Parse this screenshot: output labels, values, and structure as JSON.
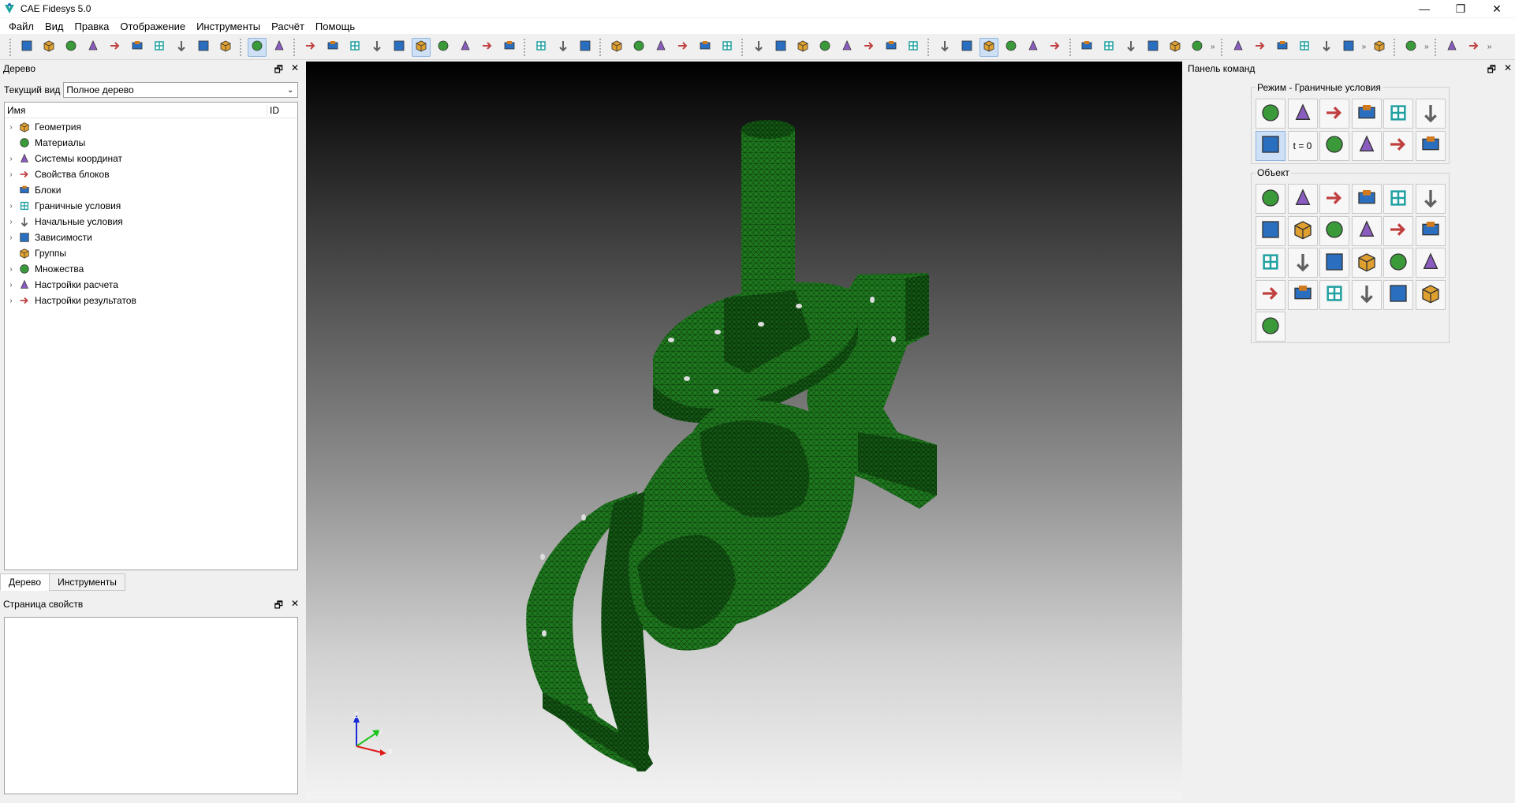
{
  "window": {
    "title": "CAE Fidesys 5.0",
    "minimize": "—",
    "restore": "❐",
    "close": "✕"
  },
  "menu": [
    "Файл",
    "Вид",
    "Правка",
    "Отображение",
    "Инструменты",
    "Расчёт",
    "Помощь"
  ],
  "toolbar": {
    "icons": [
      "new-file-icon",
      "open-folder-icon",
      "save-icon",
      "import-icon",
      "export-icon",
      "script-icon",
      "play-script-icon",
      "id-icon",
      "record-icon",
      "hammer-icon",
      "select-icon",
      "undo-icon",
      "wireframe-cube-icon",
      "hidden-cube-icon",
      "shaded-cube-icon",
      "solid-cube-icon",
      "smooth-shade-icon",
      "mesh-cube-icon",
      "geometry-mesh-icon",
      "grid-icon",
      "transparent-cube-icon",
      "cut-icon",
      "rotate-icon",
      "zoom-in-icon",
      "zoom-out-icon",
      "fit-icon",
      "perspective-icon",
      "view-front-icon",
      "view-back-icon",
      "view-left-icon",
      "view-right-icon",
      "view-top-icon",
      "view-iso-icon",
      "frame-icon",
      "frame2-icon",
      "frame3-icon",
      "axes-icon",
      "dimension-icon",
      "ruler-icon",
      "multi-body-icon",
      "volume-icon",
      "surface-icon",
      "surface2-icon",
      "curve-icon",
      "point-icon",
      "node-icon",
      "edge-icon",
      "face-icon",
      "cell-icon",
      "mesh-edges-icon",
      "group-icon",
      "force-icon",
      "pressure-icon",
      "arrow-load-icon",
      "boundary-icon",
      "temperature-icon",
      "velocity-icon",
      "acceleration-icon",
      "mesh-frame-icon",
      "run-icon",
      "coordinate-icon"
    ],
    "more": "»"
  },
  "tree_panel": {
    "title": "Дерево",
    "current_view_label": "Текущий вид",
    "current_view_value": "Полное дерево",
    "col_name": "Имя",
    "col_id": "ID",
    "items": [
      {
        "label": "Геометрия",
        "icon": "geometry-icon",
        "expandable": true
      },
      {
        "label": "Материалы",
        "icon": "materials-icon",
        "expandable": false
      },
      {
        "label": "Системы координат",
        "icon": "coordinate-systems-icon",
        "expandable": true
      },
      {
        "label": "Свойства блоков",
        "icon": "block-properties-icon",
        "expandable": true
      },
      {
        "label": "Блоки",
        "icon": "blocks-icon",
        "expandable": false
      },
      {
        "label": "Граничные условия",
        "icon": "boundary-conditions-icon",
        "expandable": true
      },
      {
        "label": "Начальные условия",
        "icon": "initial-conditions-icon",
        "expandable": true
      },
      {
        "label": "Зависимости",
        "icon": "dependencies-icon",
        "expandable": true
      },
      {
        "label": "Группы",
        "icon": "groups-icon",
        "expandable": false
      },
      {
        "label": "Множества",
        "icon": "sets-icon",
        "expandable": true
      },
      {
        "label": "Настройки расчета",
        "icon": "calc-settings-icon",
        "expandable": true
      },
      {
        "label": "Настройки результатов",
        "icon": "result-settings-icon",
        "expandable": true
      }
    ],
    "tabs": [
      "Дерево",
      "Инструменты"
    ]
  },
  "properties_panel": {
    "title": "Страница свойств"
  },
  "command_panel": {
    "title": "Панель команд",
    "mode_label": "Режим - Граничные условия",
    "object_label": "Объект",
    "t0_label": "t = 0",
    "mode_icons": [
      "geometry-mode-icon",
      "mesh-mode-icon",
      "materials-mode-icon",
      "coordinates-mode-icon",
      "blocks-mode-icon",
      "sets-mode-icon",
      "boundary-mode-icon",
      "initial-mode-icon",
      "dependencies-mode-icon",
      "calculation-mode-icon",
      "settings-mode-icon",
      "results-mode-icon"
    ],
    "object_icons": [
      "fixed-support-icon",
      "force-icon",
      "distributed-load-icon",
      "pressure-icon",
      "gravity-icon",
      "point-mass-icon",
      "velocity-icon",
      "angular-velocity-icon",
      "acceleration-icon",
      "contact-icon",
      "symmetry-icon",
      "spring-icon",
      "temperature-icon",
      "heat-flux-icon",
      "convection-icon",
      "radiation-icon",
      "heat-source-icon",
      "heat-generation-icon",
      "volume-heat-icon",
      "flow-icon",
      "light-icon",
      "sun-icon",
      "pipe-icon",
      "constraint-icon",
      "lattice-icon"
    ]
  },
  "axis_triad": {
    "z": "Z",
    "y": "Y",
    "x": "X"
  }
}
